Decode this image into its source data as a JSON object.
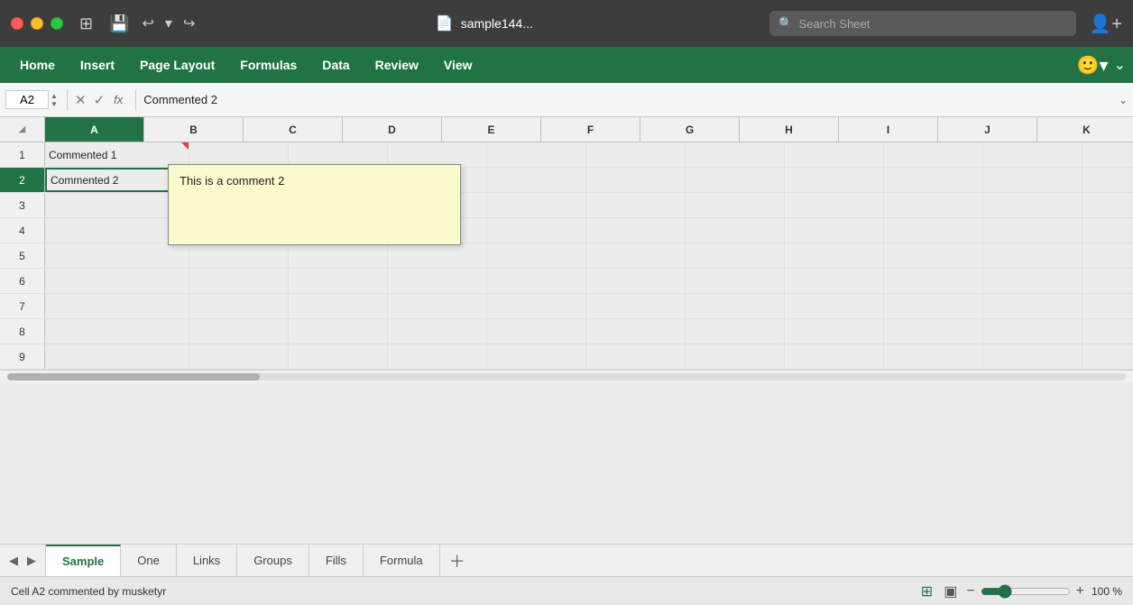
{
  "titlebar": {
    "file_name": "sample144...",
    "search_placeholder": "Search Sheet"
  },
  "menubar": {
    "items": [
      "Home",
      "Insert",
      "Page Layout",
      "Formulas",
      "Data",
      "Review",
      "View"
    ]
  },
  "formulabar": {
    "cell_ref": "A2",
    "formula": "Commented 2"
  },
  "columns": [
    "A",
    "B",
    "C",
    "D",
    "E",
    "F",
    "G",
    "H",
    "I",
    "J",
    "K"
  ],
  "rows": [
    {
      "num": 1,
      "cells": [
        "Commented 1",
        "",
        "",
        "",
        "",
        "",
        "",
        "",
        "",
        "",
        ""
      ]
    },
    {
      "num": 2,
      "cells": [
        "Commented 2",
        "",
        "",
        "",
        "",
        "",
        "",
        "",
        "",
        "",
        ""
      ]
    },
    {
      "num": 3,
      "cells": [
        "",
        "",
        "",
        "",
        "",
        "",
        "",
        "",
        "",
        "",
        ""
      ]
    },
    {
      "num": 4,
      "cells": [
        "",
        "",
        "",
        "",
        "",
        "",
        "",
        "",
        "",
        "",
        ""
      ]
    },
    {
      "num": 5,
      "cells": [
        "",
        "",
        "",
        "",
        "",
        "",
        "",
        "",
        "",
        "",
        ""
      ]
    },
    {
      "num": 6,
      "cells": [
        "",
        "",
        "",
        "",
        "",
        "",
        "",
        "",
        "",
        "",
        ""
      ]
    },
    {
      "num": 7,
      "cells": [
        "",
        "",
        "",
        "",
        "",
        "",
        "",
        "",
        "",
        "",
        ""
      ]
    },
    {
      "num": 8,
      "cells": [
        "",
        "",
        "",
        "",
        "",
        "",
        "",
        "",
        "",
        "",
        ""
      ]
    },
    {
      "num": 9,
      "cells": [
        "",
        "",
        "",
        "",
        "",
        "",
        "",
        "",
        "",
        "",
        ""
      ]
    }
  ],
  "comment_popup": {
    "text": "This is a comment 2"
  },
  "tabs": {
    "items": [
      "Sample",
      "One",
      "Links",
      "Groups",
      "Fills",
      "Formula"
    ],
    "active": "Sample"
  },
  "statusbar": {
    "text": "Cell A2 commented by musketyr",
    "zoom": "100 %"
  }
}
